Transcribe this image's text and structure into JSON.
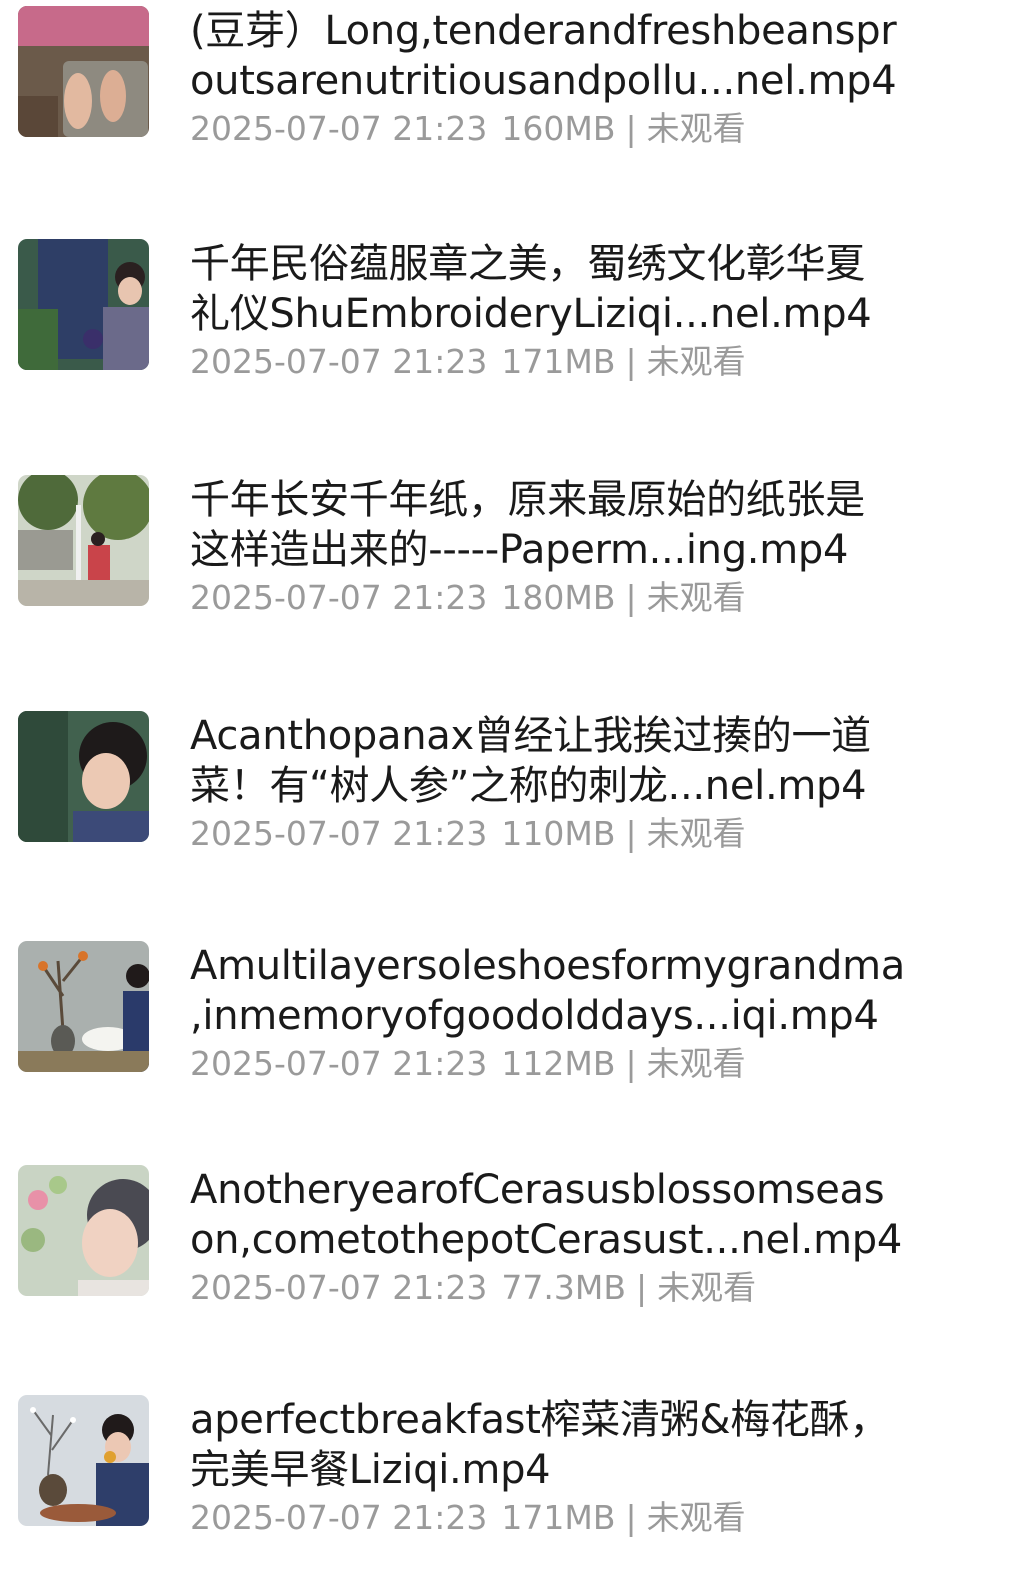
{
  "files": [
    {
      "title_line1": "(豆芽）Long,tenderandfreshbeanspr",
      "title_line2": "outsarenutritiousandpollu...nel.mp4",
      "date": "2025-07-07 21:23",
      "size": "160MB",
      "status": "未观看",
      "thumb": "hands-on-stone"
    },
    {
      "title_line1": "千年民俗蕴服章之美，蜀绣文化彰华夏",
      "title_line2": "礼仪ShuEmbroideryLiziqi...nel.mp4",
      "date": "2025-07-07 21:23",
      "size": "171MB",
      "status": "未观看",
      "thumb": "woman-embroidery"
    },
    {
      "title_line1": "千年长安千年纸，原来最原始的纸张是",
      "title_line2": "这样造出来的-----Paperm...ing.mp4",
      "date": "2025-07-07 21:23",
      "size": "180MB",
      "status": "未观看",
      "thumb": "village-trees"
    },
    {
      "title_line1": "Acanthopanax曾经让我挨过揍的一道",
      "title_line2": "菜！有“树人参”之称的刺龙...nel.mp4",
      "date": "2025-07-07 21:23",
      "size": "110MB",
      "status": "未观看",
      "thumb": "woman-profile"
    },
    {
      "title_line1": "Amultilayersoleshoesformygrandma",
      "title_line2": ",inmemoryofgoodolddays...iqi.mp4",
      "date": "2025-07-07 21:23",
      "size": "112MB",
      "status": "未观看",
      "thumb": "woman-table-vase"
    },
    {
      "title_line1": "AnotheryearofCerasusblossomseas",
      "title_line2": "on,cometothepotCerasust...nel.mp4",
      "date": "2025-07-07 21:23",
      "size": "77.3MB",
      "status": "未观看",
      "thumb": "woman-blossom"
    },
    {
      "title_line1": "aperfectbreakfast榨菜清粥&梅花酥，",
      "title_line2": "完美早餐Liziqi.mp4",
      "date": "2025-07-07 21:23",
      "size": "171MB",
      "status": "未观看",
      "thumb": "woman-breakfast"
    }
  ]
}
